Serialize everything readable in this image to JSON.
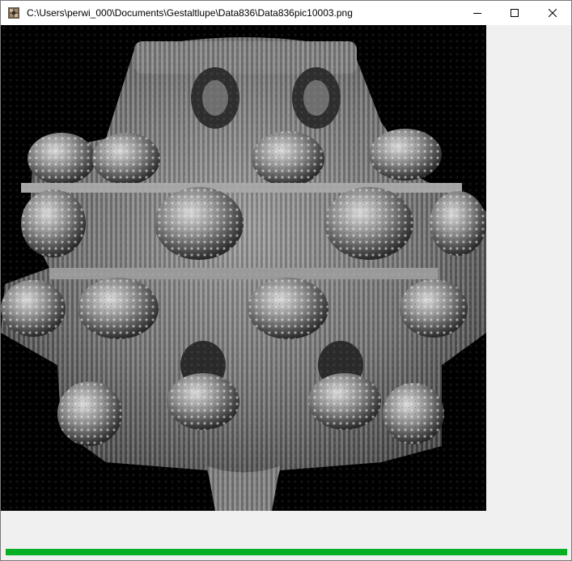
{
  "window": {
    "title": "C:\\Users\\perwi_000\\Documents\\Gestaltlupe\\Data836\\Data836pic10003.png",
    "app_icon": "fractal-app-icon",
    "controls": {
      "minimize_icon": "minimize-icon",
      "maximize_icon": "maximize-icon",
      "close_icon": "close-icon"
    }
  },
  "image": {
    "subject": "grayscale 3d fractal render",
    "background_color": "#000000"
  },
  "progress": {
    "fraction": 1.0,
    "color": "#06b025"
  }
}
